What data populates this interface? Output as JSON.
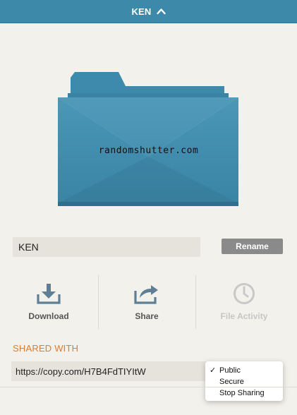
{
  "header": {
    "title": "KEN",
    "toggle_icon": "chevron-up-icon",
    "bg_color": "#3d89a9"
  },
  "folder": {
    "icon": "folder-icon",
    "color": "#3d89a9",
    "watermark": "randomshutter.com"
  },
  "name_field": {
    "value": "KEN"
  },
  "rename_button": {
    "label": "Rename"
  },
  "actions": [
    {
      "label": "Download",
      "icon": "download-icon",
      "enabled": true
    },
    {
      "label": "Share",
      "icon": "share-icon",
      "enabled": true
    },
    {
      "label": "File Activity",
      "icon": "clock-icon",
      "enabled": false
    }
  ],
  "shared_with": {
    "label": "SHARED WITH",
    "label_color": "#e07a2e",
    "url": "https://copy.com/H7B4FdTIYItW",
    "options": [
      {
        "label": "Public",
        "checked": true
      },
      {
        "label": "Secure",
        "checked": false
      },
      {
        "label": "Stop Sharing",
        "checked": false
      }
    ],
    "check_mark": "✓"
  }
}
